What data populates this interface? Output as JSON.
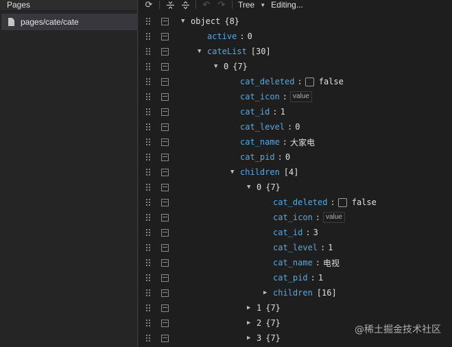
{
  "pages_panel": {
    "title": "Pages",
    "items": [
      {
        "label": "pages/cate/cate",
        "selected": true
      }
    ]
  },
  "toolbar": {
    "refresh_icon": "⟳",
    "collapse_all_icon": "collapse-all",
    "expand_all_icon": "expand-all",
    "undo_icon": "↶",
    "redo_icon": "↷",
    "view_mode": "Tree",
    "caret": "▼",
    "status": "Editing..."
  },
  "tree": {
    "rows": [
      {
        "depth": 0,
        "toggle": "▼",
        "key": "object",
        "key_style": "root",
        "meta": "{8}"
      },
      {
        "depth": 1,
        "toggle": "",
        "key": "active",
        "value": "0"
      },
      {
        "depth": 1,
        "toggle": "▼",
        "key": "cateList",
        "meta": "[30]"
      },
      {
        "depth": 2,
        "toggle": "▼",
        "index": "0",
        "meta": "{7}"
      },
      {
        "depth": 3,
        "toggle": "",
        "key": "cat_deleted",
        "checkbox": true,
        "value": "false"
      },
      {
        "depth": 3,
        "toggle": "",
        "key": "cat_icon",
        "input_value": "value"
      },
      {
        "depth": 3,
        "toggle": "",
        "key": "cat_id",
        "value": "1"
      },
      {
        "depth": 3,
        "toggle": "",
        "key": "cat_level",
        "value": "0"
      },
      {
        "depth": 3,
        "toggle": "",
        "key": "cat_name",
        "value": "大家电",
        "cn": true
      },
      {
        "depth": 3,
        "toggle": "",
        "key": "cat_pid",
        "value": "0"
      },
      {
        "depth": 3,
        "toggle": "▼",
        "key": "children",
        "meta": "[4]"
      },
      {
        "depth": 4,
        "toggle": "▼",
        "index": "0",
        "meta": "{7}"
      },
      {
        "depth": 5,
        "toggle": "",
        "key": "cat_deleted",
        "checkbox": true,
        "value": "false"
      },
      {
        "depth": 5,
        "toggle": "",
        "key": "cat_icon",
        "input_value": "value"
      },
      {
        "depth": 5,
        "toggle": "",
        "key": "cat_id",
        "value": "3"
      },
      {
        "depth": 5,
        "toggle": "",
        "key": "cat_level",
        "value": "1"
      },
      {
        "depth": 5,
        "toggle": "",
        "key": "cat_name",
        "value": "电视",
        "cn": true
      },
      {
        "depth": 5,
        "toggle": "",
        "key": "cat_pid",
        "value": "1"
      },
      {
        "depth": 5,
        "toggle": "▶",
        "key": "children",
        "meta": "[16]"
      },
      {
        "depth": 4,
        "toggle": "▶",
        "index": "1",
        "meta": "{7}"
      },
      {
        "depth": 4,
        "toggle": "▶",
        "index": "2",
        "meta": "{7}"
      },
      {
        "depth": 4,
        "toggle": "▶",
        "index": "3",
        "meta": "{7}"
      }
    ]
  },
  "watermark": "@稀土掘金技术社区"
}
